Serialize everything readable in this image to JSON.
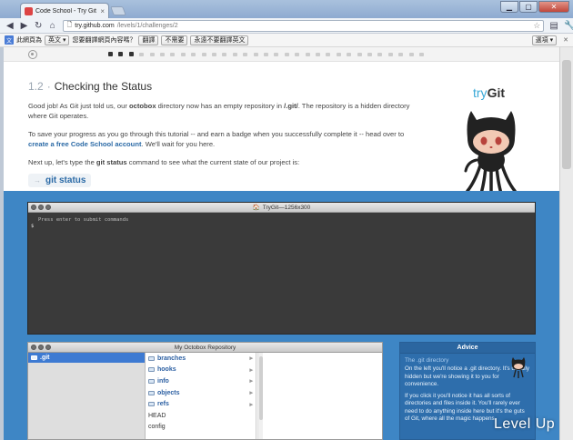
{
  "browser": {
    "tab_title": "Code School - Try Git",
    "url_host": "try.github.com",
    "url_path": "/levels/1/challenges/2",
    "translate": {
      "label": "此網頁為",
      "language": "英文",
      "question": "您要翻譯網頁內容嗎？",
      "translate_btn": "翻譯",
      "no_btn": "不需要",
      "never_btn": "永遠不要翻譯英文",
      "options_btn": "選項"
    }
  },
  "lesson": {
    "number": "1.2",
    "title": "Checking the Status",
    "p1_a": "Good job! As Git just told us, our ",
    "p1_b": "octobox",
    "p1_c": " directory now has an empty repository in ",
    "p1_d": "/.git/",
    "p1_e": ". The repository is a hidden directory where Git operates.",
    "p2_a": "To save your progress as you go through this tutorial -- and earn a badge when you successfully complete it -- head over to ",
    "p2_link": "create a free Code School account",
    "p2_b": ". We'll wait for you here.",
    "p3_a": "Next up, let's type the ",
    "p3_b": "git status",
    "p3_c": " command to see what the current state of our project is:",
    "command": "git status"
  },
  "brand": {
    "try": "try",
    "git": "Git"
  },
  "terminal": {
    "title": "TryGit—1256x300",
    "hint": "Press enter to submit commands",
    "prompt": "$"
  },
  "repo": {
    "title": "My Octobox Repository",
    "selected": ".git",
    "entries": [
      {
        "name": "branches",
        "type": "dir"
      },
      {
        "name": "hooks",
        "type": "dir"
      },
      {
        "name": "info",
        "type": "dir"
      },
      {
        "name": "objects",
        "type": "dir"
      },
      {
        "name": "refs",
        "type": "dir"
      },
      {
        "name": "HEAD",
        "type": "file"
      },
      {
        "name": "config",
        "type": "file"
      }
    ]
  },
  "advice": {
    "title": "Advice",
    "subtitle": "The .git directory",
    "p1": "On the left you'll notice a .git directory. It's usually hidden but we're showing it to you for convenience.",
    "p2": "If you click it you'll notice it has all sorts of directories and files inside it. You'll rarely ever need to do anything inside here but it's the guts of Git, where all the magic happens."
  },
  "watermark": "Level Up",
  "progress": {
    "completed_steps": 3,
    "total_steps": 31
  },
  "colors": {
    "accent": "#2b6aa6",
    "panel_blue": "#3e86c5",
    "brand_cyan": "#39a9d7"
  }
}
